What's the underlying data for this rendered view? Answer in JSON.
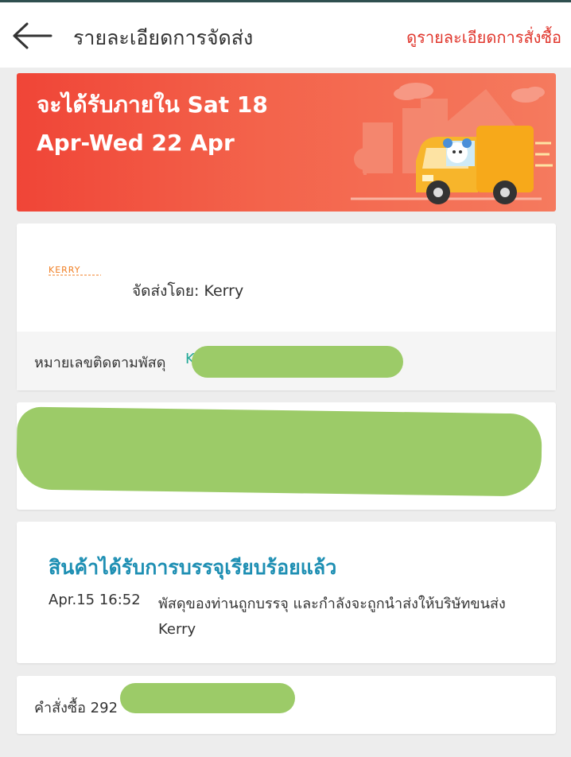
{
  "header": {
    "title": "รายละเอียดการจัดส่ง",
    "order_details_link": "ดูรายละเอียดการสั่งซื้อ"
  },
  "banner": {
    "eta_text": "จะได้รับภายใน Sat 18 Apr-Wed 22 Apr"
  },
  "shipping": {
    "carrier_logo_text": "KERRY",
    "carrier_text": "จัดส่งโดย: Kerry",
    "tracking_label": "หมายเลขติดตามพัสดุ",
    "tracking_visible": "K"
  },
  "status": {
    "title": "สินค้าได้รับการบรรจุเรียบร้อยแล้ว",
    "events": [
      {
        "time": "Apr.15 16:52",
        "description": "พัสดุของท่านถูกบรรจุ และกำลังจะถูกนำส่งให้บริษัทขนส่ง Kerry"
      }
    ]
  },
  "order": {
    "number_text": "คำสั่งซื้อ 292"
  },
  "colors": {
    "accent_red": "#e0352b",
    "status_blue": "#1e8fb3",
    "redaction_green": "#9ccb68"
  }
}
